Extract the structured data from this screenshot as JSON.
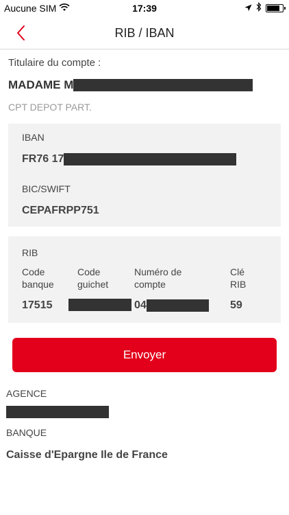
{
  "status_bar": {
    "carrier": "Aucune SIM",
    "time": "17:39",
    "battery_level": 0.9
  },
  "nav": {
    "title": "RIB / IBAN",
    "back_icon": "chevron-left-icon",
    "accent_color": "#e2001a"
  },
  "holder": {
    "label": "Titulaire du compte :",
    "name_prefix": "MADAME M",
    "account_type": "CPT DEPOT PART."
  },
  "iban_card": {
    "iban_label": "IBAN",
    "iban_prefix": "FR76 17",
    "bic_label": "BIC/SWIFT",
    "bic_value": "CEPAFRPP751"
  },
  "rib_card": {
    "title": "RIB",
    "code_banque_label": "Code\nbanque",
    "code_guichet_label": "Code\nguichet",
    "numero_compte_label": "Numéro de\ncompte",
    "cle_rib_label": "Clé\nRIB",
    "code_banque_value": "17515",
    "numero_compte_prefix": "04",
    "cle_rib_value": "59"
  },
  "actions": {
    "send_label": "Envoyer",
    "send_color": "#e2001a"
  },
  "agency": {
    "agency_label": "AGENCE",
    "bank_label": "BANQUE",
    "bank_value": "Caisse d'Epargne Ile de France"
  }
}
